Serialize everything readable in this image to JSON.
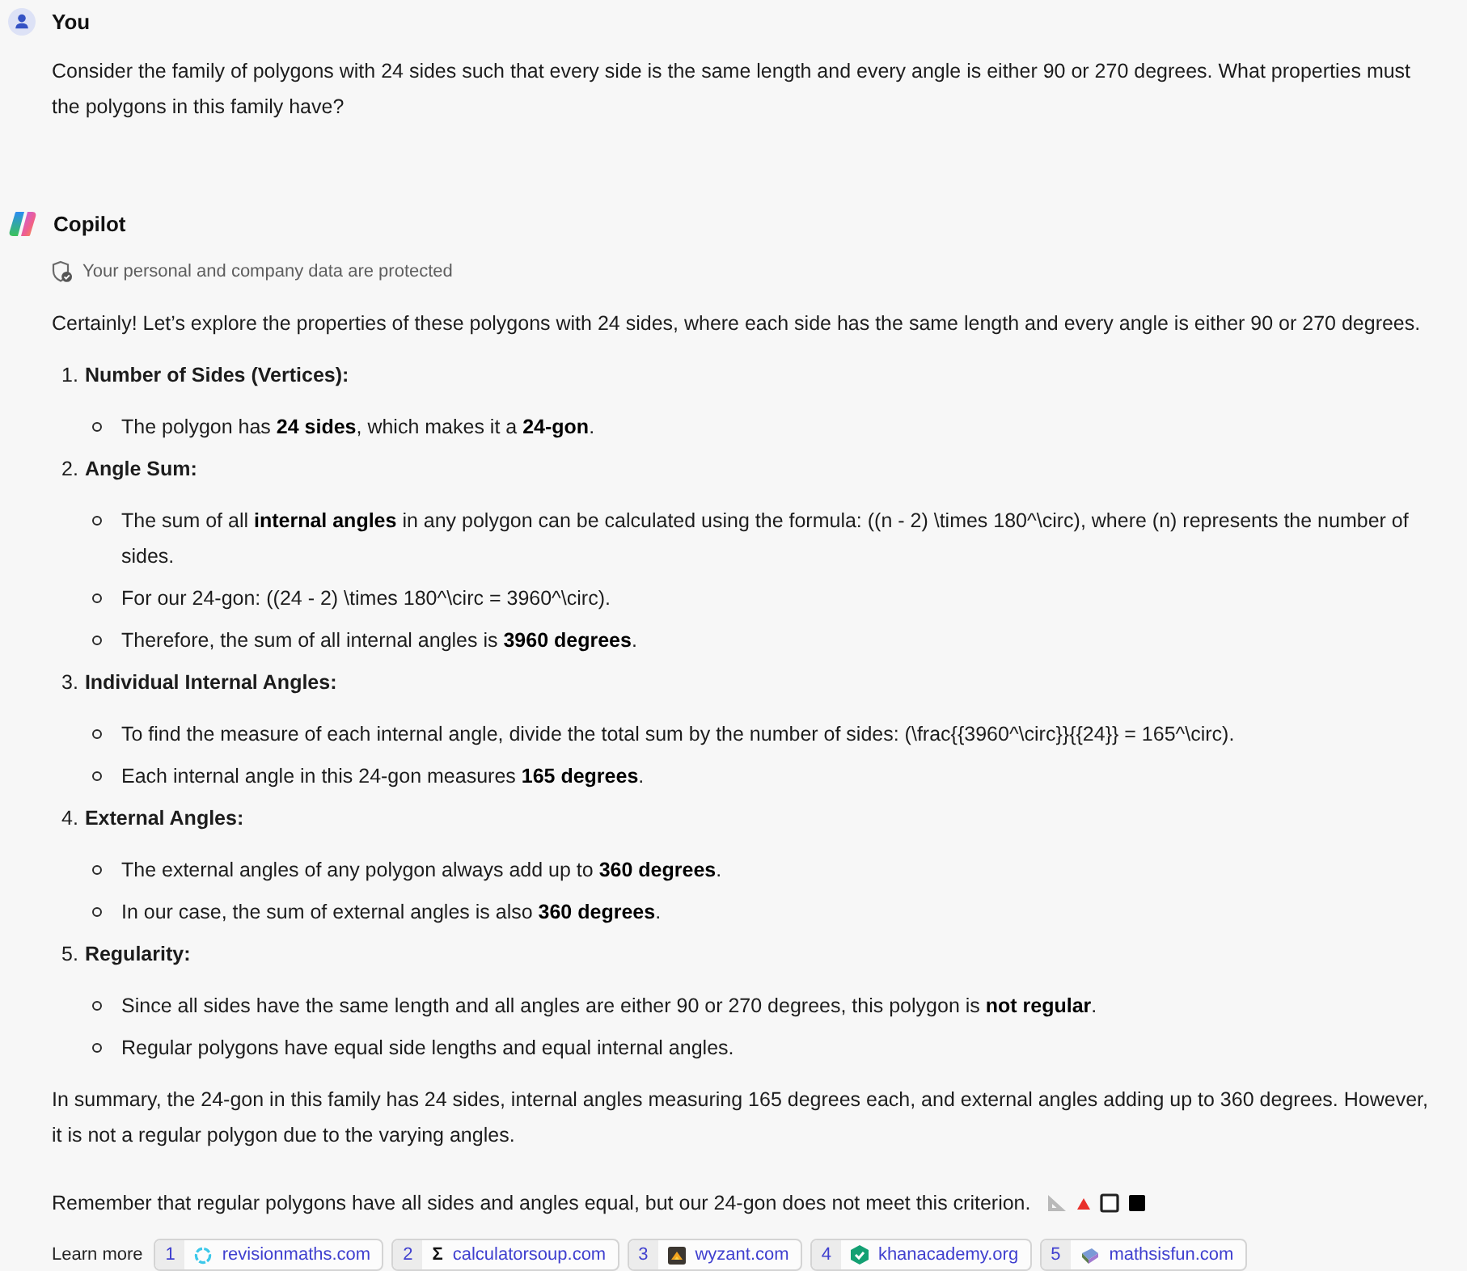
{
  "messages": [
    {
      "kind": "user",
      "author": "You",
      "text": "Consider the family of polygons with 24 sides such that every side is the same length and every angle is either 90 or 270 degrees. What properties must the polygons in this family have?"
    },
    {
      "kind": "assistant",
      "author": "Copilot",
      "privacy_note": "Your personal and company data are protected",
      "intro": "Certainly! Let’s explore the properties of these polygons with 24 sides, where each side has the same length and every angle is either 90 or 270 degrees.",
      "sections": [
        {
          "number": "1.",
          "title": "Number of Sides (Vertices):",
          "bullets": [
            "The polygon has **24 sides**, which makes it a **24-gon**."
          ]
        },
        {
          "number": "2.",
          "title": "Angle Sum:",
          "bullets": [
            "The sum of all **internal angles** in any polygon can be calculated using the formula: ((n - 2) \\times 180^\\circ), where (n) represents the number of sides.",
            "For our 24-gon: ((24 - 2) \\times 180^\\circ = 3960^\\circ).",
            "Therefore, the sum of all internal angles is **3960 degrees**."
          ]
        },
        {
          "number": "3.",
          "title": "Individual Internal Angles:",
          "bullets": [
            "To find the measure of each internal angle, divide the total sum by the number of sides: (\\frac{{3960^\\circ}}{{24}} = 165^\\circ).",
            "Each internal angle in this 24-gon measures **165 degrees**."
          ]
        },
        {
          "number": "4.",
          "title": "External Angles:",
          "bullets": [
            "The external angles of any polygon always add up to **360 degrees**.",
            "In our case, the sum of external angles is also **360 degrees**."
          ]
        },
        {
          "number": "5.",
          "title": "Regularity:",
          "bullets": [
            "Since all sides have the same length and all angles are either 90 or 270 degrees, this polygon is **not regular**.",
            "Regular polygons have equal side lengths and equal internal angles."
          ]
        }
      ],
      "summary": "In summary, the 24-gon in this family has 24 sides, internal angles measuring 165 degrees each, and external angles adding up to 360 degrees. However, it is not a regular polygon due to the varying angles.",
      "closing": "Remember that regular polygons have all sides and angles equal, but our 24-gon does not meet this criterion.",
      "learn_more": {
        "label": "Learn more",
        "sources": [
          {
            "number": "1",
            "kind": "ring",
            "domain": "revisionmaths.com"
          },
          {
            "number": "2",
            "kind": "glyph",
            "glyph": "Σ",
            "domain": "calculatorsoup.com"
          },
          {
            "number": "3",
            "kind": "tile",
            "domain": "wyzant.com"
          },
          {
            "number": "4",
            "kind": "hexagon",
            "domain": "khanacademy.org"
          },
          {
            "number": "5",
            "kind": "book",
            "domain": "mathsisfun.com"
          }
        ]
      }
    }
  ]
}
